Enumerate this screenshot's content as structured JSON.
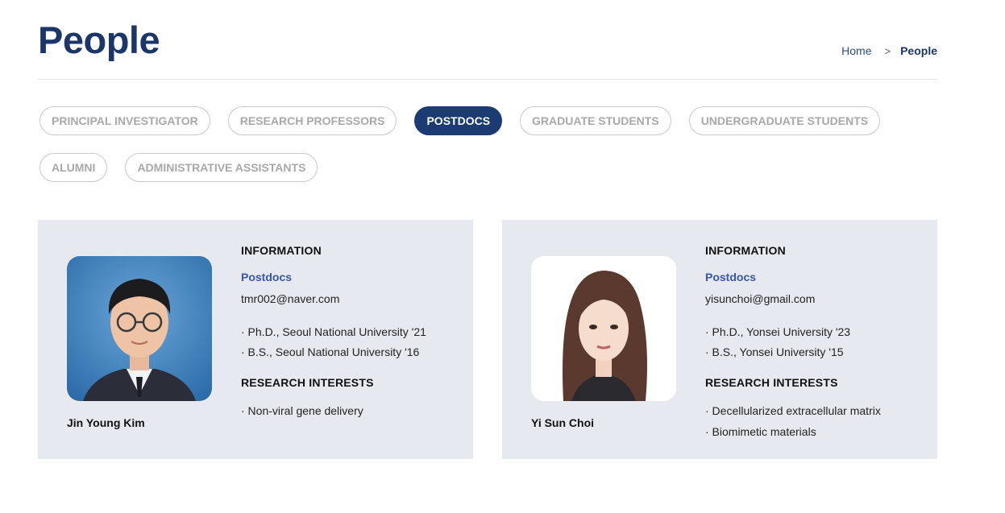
{
  "header": {
    "title": "People",
    "breadcrumb": {
      "home": "Home",
      "separator": ">",
      "current": "People"
    }
  },
  "tabs": [
    {
      "label": "PRINCIPAL INVESTIGATOR",
      "active": false
    },
    {
      "label": "RESEARCH PROFESSORS",
      "active": false
    },
    {
      "label": "POSTDOCS",
      "active": true
    },
    {
      "label": "GRADUATE STUDENTS",
      "active": false
    },
    {
      "label": "UNDERGRADUATE STUDENTS",
      "active": false
    },
    {
      "label": "ALUMNI",
      "active": false
    },
    {
      "label": "ADMINISTRATIVE ASSISTANTS",
      "active": false
    }
  ],
  "people": [
    {
      "name": "Jin Young Kim",
      "info_title": "INFORMATION",
      "role": "Postdocs",
      "email": "tmr002@naver.com",
      "education": [
        "· Ph.D., Seoul National University '21",
        "· B.S., Seoul National University '16"
      ],
      "interests_title": "RESEARCH INTERESTS",
      "interests": [
        "· Non-viral gene delivery"
      ]
    },
    {
      "name": "Yi Sun Choi",
      "info_title": "INFORMATION",
      "role": "Postdocs",
      "email": "yisunchoi@gmail.com",
      "education": [
        "· Ph.D., Yonsei University '23",
        "· B.S., Yonsei University '15"
      ],
      "interests_title": "RESEARCH INTERESTS",
      "interests": [
        "· Decellularized extracellular matrix",
        "· Biomimetic materials"
      ]
    }
  ],
  "colors": {
    "brand": "#1b3668",
    "active_tab": "#1b3b72",
    "role": "#3a55a8",
    "card_bg": "#e6e9f0"
  }
}
